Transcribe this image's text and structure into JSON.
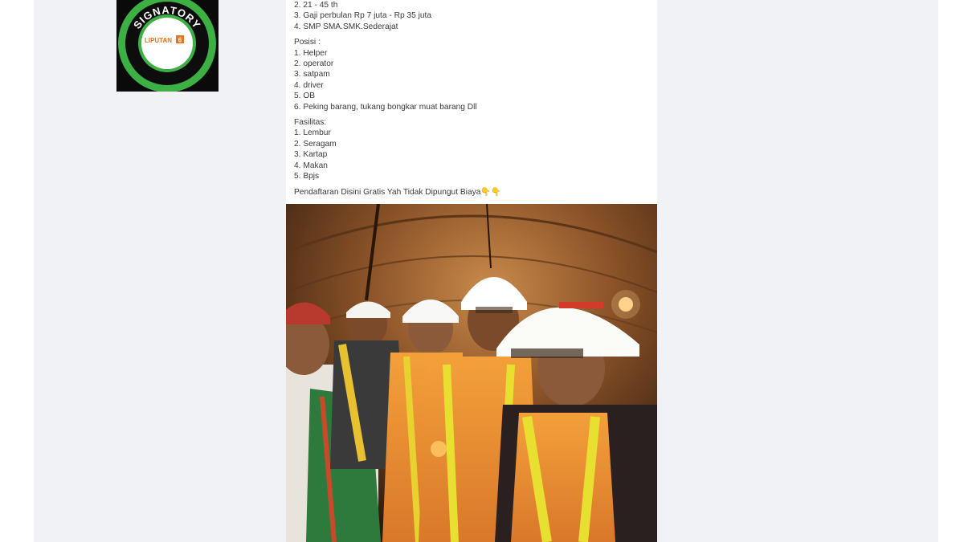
{
  "post": {
    "requirements_tail": [
      "2. 21 - 45 th",
      "3. Gaji perbulan Rp 7 juta - Rp 35 juta",
      "4. SMP SMA.SMK.Sederajat"
    ],
    "positions_heading": "Posisi :",
    "positions": [
      "1. Helper",
      "2. operator",
      "3. satpam",
      "4. driver",
      "5. OB",
      "6. Peking barang, tukang bongkar muat barang Dll"
    ],
    "facilities_heading": "Fasilitas:",
    "facilities": [
      "1. Lembur",
      "2. Seragam",
      "3. Kartap",
      "4. Makan",
      "5. Bpjs"
    ],
    "cta": "Pendaftaran Disini Gratis Yah Tidak Dipungut Biaya👇👇"
  },
  "badge": {
    "ring_text": "SIGNATORY",
    "logo_text": "LIPUTAN",
    "logo_number": "6",
    "ring_color": "#3cb043"
  }
}
